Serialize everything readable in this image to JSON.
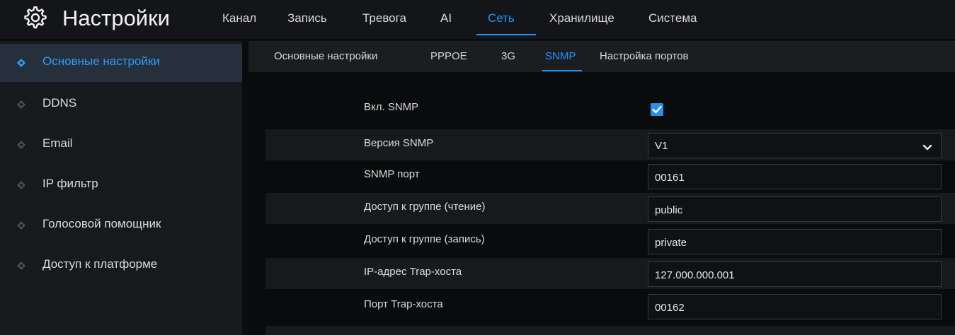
{
  "header": {
    "title": "Настройки",
    "icon": "gear-icon",
    "tabs": [
      {
        "label": "Канал"
      },
      {
        "label": "Запись"
      },
      {
        "label": "Тревога"
      },
      {
        "label": "AI"
      },
      {
        "label": "Сеть",
        "active": true
      },
      {
        "label": "Хранилище"
      },
      {
        "label": "Система"
      }
    ]
  },
  "sidebar": {
    "items": [
      {
        "label": "Основные настройки",
        "active": true
      },
      {
        "label": "DDNS"
      },
      {
        "label": "Email"
      },
      {
        "label": "IP фильтр"
      },
      {
        "label": "Голосовой помощник"
      },
      {
        "label": "Доступ к платформе"
      }
    ]
  },
  "subtabs": [
    {
      "label": "Основные настройки"
    },
    {
      "label": "PPPOE"
    },
    {
      "label": "3G"
    },
    {
      "label": "SNMP",
      "active": true
    },
    {
      "label": "Настройка портов"
    }
  ],
  "form": {
    "enable": {
      "label": "Вкл. SNMP",
      "checked": true
    },
    "version": {
      "label": "Версия SNMP",
      "value": "V1"
    },
    "port": {
      "label": "SNMP порт",
      "value": "00161"
    },
    "read_community": {
      "label": "Доступ к группе (чтение)",
      "value": "public"
    },
    "write_community": {
      "label": "Доступ к группе (запись)",
      "value": "private"
    },
    "trap_ip": {
      "label": "IP-адрес Trap-хоста",
      "value": "127.000.000.001"
    },
    "trap_port": {
      "label": "Порт Trap-хоста",
      "value": "00162"
    }
  },
  "colors": {
    "accent": "#1f93ff",
    "background": "#0b0c0e",
    "panel": "#17191c"
  }
}
